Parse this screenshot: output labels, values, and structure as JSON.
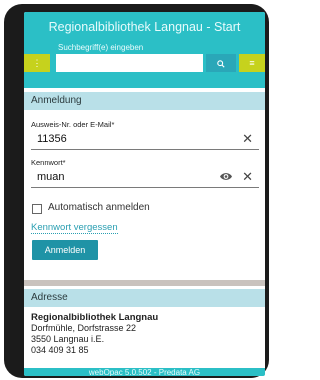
{
  "header": {
    "title": "Regionalbibliothek Langnau - Start",
    "search_label": "Suchbegriff(e) eingeben",
    "search_placeholder": "",
    "menu_icon": "more-vertical-icon",
    "search_icon": "search-icon",
    "more_icon": "menu-icon"
  },
  "login": {
    "heading": "Anmeldung",
    "id_label": "Ausweis-Nr. oder E-Mail*",
    "id_value": "11356",
    "password_label": "Kennwort*",
    "password_value": "muan",
    "auto_login_label": "Automatisch anmelden",
    "forgot_link": "Kennwort vergessen",
    "submit_label": "Anmelden",
    "icons": {
      "clear": "close-icon",
      "show_password": "eye-icon"
    }
  },
  "address": {
    "heading": "Adresse",
    "name": "Regionalbibliothek Langnau",
    "street": "Dorfmühle, Dorfstrasse 22",
    "city": "3550 Langnau i.E.",
    "phone": "034 409 31 85"
  },
  "footer": {
    "text": "webOpac 5.0.502 - Predata AG"
  },
  "colors": {
    "header_bg": "#2bbfc6",
    "accent_yellow": "#c6d21d",
    "panel_head_bg": "#b9e0e8",
    "button_bg": "#1f93a6",
    "link": "#2a9fb2"
  }
}
